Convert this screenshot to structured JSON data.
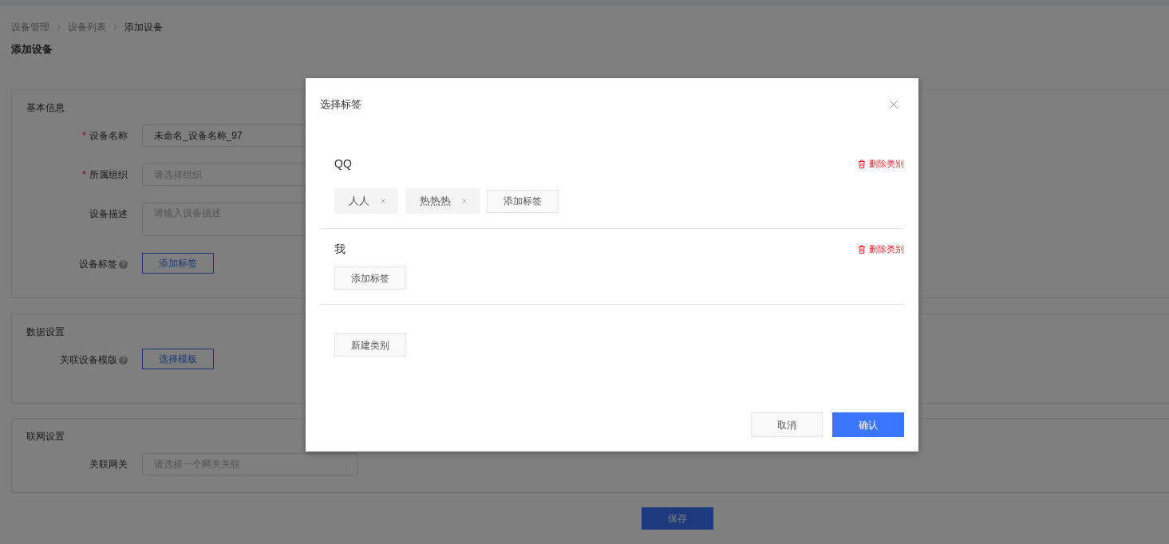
{
  "breadcrumb": [
    {
      "label": "设备管理",
      "current": false
    },
    {
      "label": "设备列表",
      "current": false
    },
    {
      "label": "添加设备",
      "current": true
    }
  ],
  "page_title": "添加设备",
  "sections": [
    {
      "title": "基本信息",
      "fields": [
        {
          "label": "设备名称",
          "required_mark": "*",
          "help": false,
          "kind": "input",
          "value": "未命名_设备名称_97"
        },
        {
          "label": "所属组织",
          "required_mark": "*",
          "help": false,
          "kind": "input",
          "placeholder": "请选择组织"
        },
        {
          "label": "设备描述",
          "help": false,
          "kind": "textarea",
          "placeholder": "请输入设备描述"
        },
        {
          "label": "设备标签",
          "help": true,
          "kind": "button",
          "button_label": "添加标签"
        }
      ]
    },
    {
      "title": "数据设置",
      "fields": [
        {
          "label": "关联设备模版",
          "help": true,
          "kind": "button",
          "button_label": "选择模板"
        }
      ]
    },
    {
      "title": "联网设置",
      "fields": [
        {
          "label": "关联网关",
          "help": false,
          "kind": "input",
          "placeholder": "请选择一个网关关联"
        }
      ]
    }
  ],
  "save_button": "保存",
  "dialog": {
    "title": "选择标签",
    "categories": [
      {
        "name": "QQ",
        "delete_label": "删除类别",
        "tags": [
          {
            "label": "人人"
          },
          {
            "label": "热热热"
          }
        ],
        "add_tag_label": "添加标签"
      },
      {
        "name": "我",
        "delete_label": "删除类别",
        "add_tag_label": "添加标签"
      }
    ],
    "new_category_label": "新建类别",
    "buttons": [
      {
        "label": "取消",
        "kind": "secondary"
      },
      {
        "label": "确认",
        "kind": "primary"
      }
    ]
  }
}
